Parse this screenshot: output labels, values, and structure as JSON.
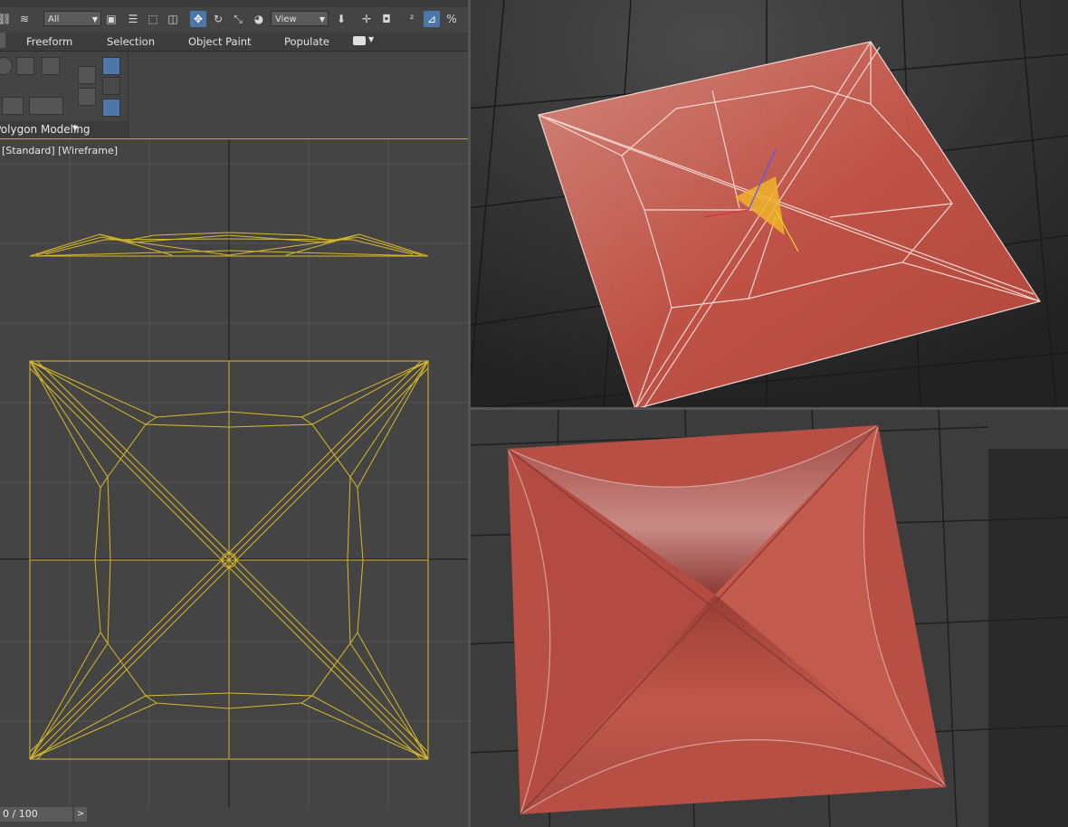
{
  "toolbar": {
    "selection_filter": "All",
    "ref_coord": "View"
  },
  "command_tabs": [
    "Freeform",
    "Selection",
    "Object Paint",
    "Populate"
  ],
  "ribbon": {
    "panel_label": "Polygon Modeling"
  },
  "viewport_left": {
    "label": "[Standard] [Wireframe]"
  },
  "timeline": {
    "frame": "0 / 100",
    "next_label": ">"
  },
  "colors": {
    "wire": "#d9b92a",
    "mesh": "#c95a4c",
    "bg": "#444444",
    "accent": "#c8a631"
  }
}
